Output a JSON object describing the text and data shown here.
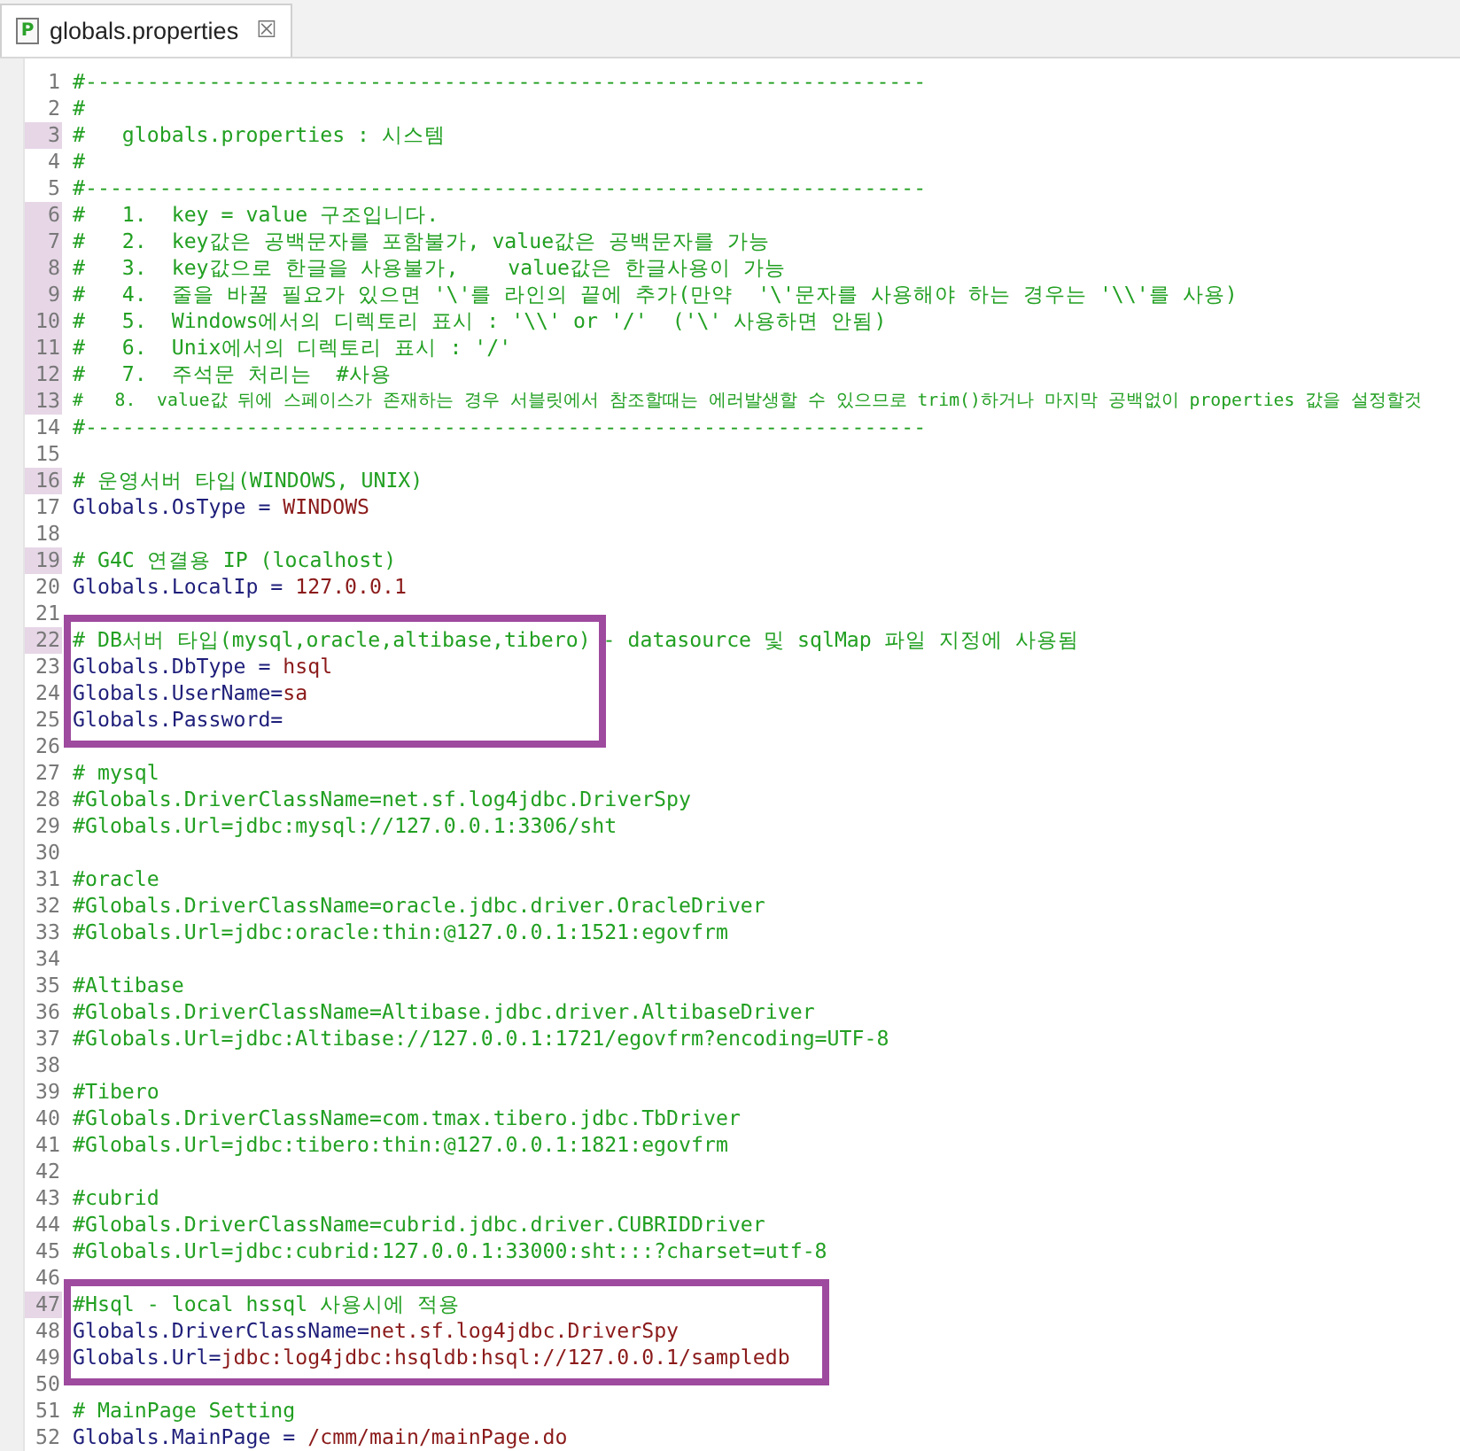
{
  "tab": {
    "title": "globals.properties",
    "icon": "P",
    "close": "☒"
  },
  "blocks": [
    {
      "highlighted": false,
      "lines": [
        {
          "n": "1",
          "kind": "comment",
          "marked": false,
          "text": "#--------------------------------------------------------------------"
        },
        {
          "n": "2",
          "kind": "comment",
          "marked": false,
          "text": "#"
        },
        {
          "n": "3",
          "kind": "comment",
          "marked": true,
          "text": "#   globals.properties : 시스템"
        },
        {
          "n": "4",
          "kind": "comment",
          "marked": false,
          "text": "#"
        },
        {
          "n": "5",
          "kind": "comment",
          "marked": false,
          "text": "#--------------------------------------------------------------------"
        },
        {
          "n": "6",
          "kind": "comment",
          "marked": true,
          "text": "#   1.  key = value 구조입니다."
        },
        {
          "n": "7",
          "kind": "comment",
          "marked": true,
          "text": "#   2.  key값은 공백문자를 포함불가, value값은 공백문자를 가능"
        },
        {
          "n": "8",
          "kind": "comment",
          "marked": true,
          "text": "#   3.  key값으로 한글을 사용불가,    value값은 한글사용이 가능"
        },
        {
          "n": "9",
          "kind": "comment",
          "marked": true,
          "text": "#   4.  줄을 바꿀 필요가 있으면 '\\'를 라인의 끝에 추가(만약  '\\'문자를 사용해야 하는 경우는 '\\\\'를 사용)"
        },
        {
          "n": "10",
          "kind": "comment",
          "marked": true,
          "text": "#   5.  Windows에서의 디렉토리 표시 : '\\\\' or '/'  ('\\' 사용하면 안됨)"
        },
        {
          "n": "11",
          "kind": "comment",
          "marked": true,
          "text": "#   6.  Unix에서의 디렉토리 표시 : '/'"
        },
        {
          "n": "12",
          "kind": "comment",
          "marked": true,
          "text": "#   7.  주석문 처리는  #사용"
        },
        {
          "n": "13",
          "kind": "comment",
          "marked": true,
          "text": "#   8.  value값 뒤에 스페이스가 존재하는 경우 서블릿에서 참조할때는 에러발생할 수 있으므로 trim()하거나 마지막 공백없이 properties 값을 설정할것"
        },
        {
          "n": "14",
          "kind": "comment",
          "marked": false,
          "text": "#--------------------------------------------------------------------"
        },
        {
          "n": "15",
          "kind": "blank",
          "marked": false
        },
        {
          "n": "16",
          "kind": "comment",
          "marked": true,
          "text": "# 운영서버 타입(WINDOWS, UNIX)"
        },
        {
          "n": "17",
          "kind": "property",
          "marked": false,
          "key": "Globals.OsType = ",
          "value": "WINDOWS"
        },
        {
          "n": "18",
          "kind": "blank",
          "marked": false
        },
        {
          "n": "19",
          "kind": "comment",
          "marked": true,
          "text": "# G4C 연결용 IP (localhost)"
        },
        {
          "n": "20",
          "kind": "property",
          "marked": false,
          "key": "Globals.LocalIp = ",
          "value": "127.0.0.1"
        },
        {
          "n": "21",
          "kind": "blank",
          "marked": false
        }
      ]
    },
    {
      "highlighted": true,
      "lines": [
        {
          "n": "22",
          "kind": "comment",
          "marked": true,
          "text": "# DB서버 타입(mysql,oracle,altibase,tibero) - datasource 및 sqlMap 파일 지정에 사용됨"
        },
        {
          "n": "23",
          "kind": "property",
          "marked": false,
          "key": "Globals.DbType = ",
          "value": "hsql"
        },
        {
          "n": "24",
          "kind": "property",
          "marked": false,
          "key": "Globals.UserName=",
          "value": "sa"
        },
        {
          "n": "25",
          "kind": "property",
          "marked": false,
          "key": "Globals.Password="
        }
      ]
    },
    {
      "highlighted": false,
      "lines": [
        {
          "n": "26",
          "kind": "blank",
          "marked": false
        },
        {
          "n": "27",
          "kind": "comment",
          "marked": false,
          "text": "# mysql"
        },
        {
          "n": "28",
          "kind": "comment",
          "marked": false,
          "text": "#Globals.DriverClassName=net.sf.log4jdbc.DriverSpy"
        },
        {
          "n": "29",
          "kind": "comment",
          "marked": false,
          "text": "#Globals.Url=jdbc:mysql://127.0.0.1:3306/sht"
        },
        {
          "n": "30",
          "kind": "blank",
          "marked": false
        },
        {
          "n": "31",
          "kind": "comment",
          "marked": false,
          "text": "#oracle"
        },
        {
          "n": "32",
          "kind": "comment",
          "marked": false,
          "text": "#Globals.DriverClassName=oracle.jdbc.driver.OracleDriver"
        },
        {
          "n": "33",
          "kind": "comment",
          "marked": false,
          "text": "#Globals.Url=jdbc:oracle:thin:@127.0.0.1:1521:egovfrm"
        },
        {
          "n": "34",
          "kind": "blank",
          "marked": false
        },
        {
          "n": "35",
          "kind": "comment",
          "marked": false,
          "text": "#Altibase"
        },
        {
          "n": "36",
          "kind": "comment",
          "marked": false,
          "text": "#Globals.DriverClassName=Altibase.jdbc.driver.AltibaseDriver"
        },
        {
          "n": "37",
          "kind": "comment",
          "marked": false,
          "text": "#Globals.Url=jdbc:Altibase://127.0.0.1:1721/egovfrm?encoding=UTF-8"
        },
        {
          "n": "38",
          "kind": "blank",
          "marked": false
        },
        {
          "n": "39",
          "kind": "comment",
          "marked": false,
          "text": "#Tibero"
        },
        {
          "n": "40",
          "kind": "comment",
          "marked": false,
          "text": "#Globals.DriverClassName=com.tmax.tibero.jdbc.TbDriver"
        },
        {
          "n": "41",
          "kind": "comment",
          "marked": false,
          "text": "#Globals.Url=jdbc:tibero:thin:@127.0.0.1:1821:egovfrm"
        },
        {
          "n": "42",
          "kind": "blank",
          "marked": false
        },
        {
          "n": "43",
          "kind": "comment",
          "marked": false,
          "text": "#cubrid"
        },
        {
          "n": "44",
          "kind": "comment",
          "marked": false,
          "text": "#Globals.DriverClassName=cubrid.jdbc.driver.CUBRIDDriver"
        },
        {
          "n": "45",
          "kind": "comment",
          "marked": false,
          "text": "#Globals.Url=jdbc:cubrid:127.0.0.1:33000:sht:::?charset=utf-8"
        },
        {
          "n": "46",
          "kind": "blank",
          "marked": false
        }
      ]
    },
    {
      "highlighted": true,
      "lines": [
        {
          "n": "47",
          "kind": "comment",
          "marked": true,
          "text": "#Hsql - local hssql 사용시에 적용"
        },
        {
          "n": "48",
          "kind": "property",
          "marked": false,
          "key": "Globals.DriverClassName=",
          "value": "net.sf.log4jdbc.DriverSpy"
        },
        {
          "n": "49",
          "kind": "property",
          "marked": false,
          "key": "Globals.Url=",
          "value": "jdbc:log4jdbc:hsqldb:hsql://127.0.0.1/sampledb"
        }
      ]
    },
    {
      "highlighted": false,
      "lines": [
        {
          "n": "50",
          "kind": "blank",
          "marked": false
        },
        {
          "n": "51",
          "kind": "comment",
          "marked": false,
          "text": "# MainPage Setting"
        },
        {
          "n": "52",
          "kind": "property",
          "marked": false,
          "key": "Globals.MainPage = ",
          "value": "/cmm/main/mainPage.do"
        }
      ]
    }
  ]
}
